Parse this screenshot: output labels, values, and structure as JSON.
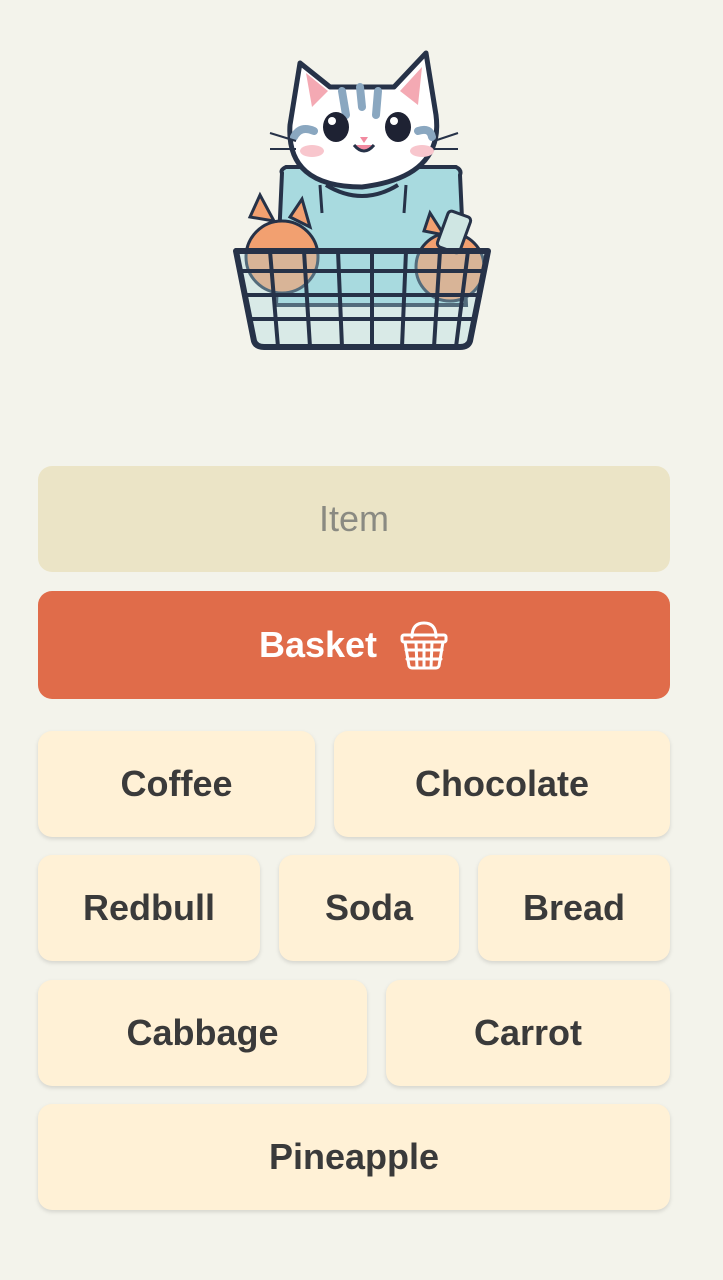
{
  "input": {
    "placeholder": "Item",
    "value": ""
  },
  "basket_button": {
    "label": "Basket",
    "icon": "basket-icon"
  },
  "items": [
    "Coffee",
    "Chocolate",
    "Redbull",
    "Soda",
    "Bread",
    "Cabbage",
    "Carrot",
    "Pineapple"
  ],
  "hero": {
    "icon": "cat-in-basket-illustration"
  },
  "colors": {
    "background": "#f3f3eb",
    "input_background": "#ebe4c6",
    "accent": "#e06c4a",
    "chip_background": "#fff1d6",
    "text": "#3a3a3a"
  }
}
